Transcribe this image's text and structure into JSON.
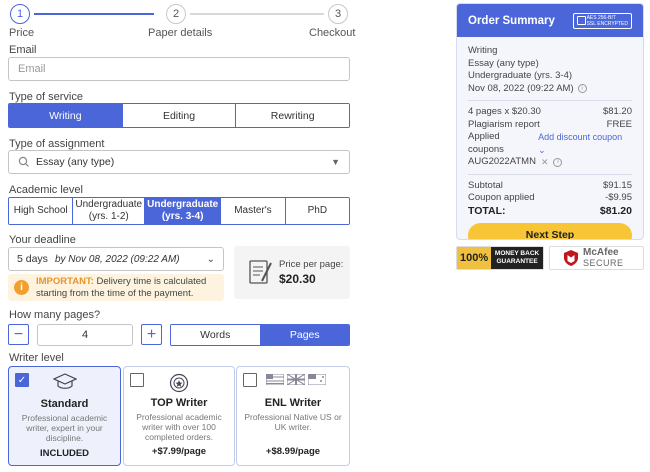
{
  "stepper": {
    "steps": [
      {
        "number": "1",
        "label": "Price"
      },
      {
        "number": "2",
        "label": "Paper details"
      },
      {
        "number": "3",
        "label": "Checkout"
      }
    ]
  },
  "email": {
    "label": "Email",
    "placeholder": "Email"
  },
  "service": {
    "label": "Type of service",
    "options": [
      "Writing",
      "Editing",
      "Rewriting"
    ],
    "selected": "Writing"
  },
  "assignment": {
    "label": "Type of assignment",
    "value": "Essay (any type)"
  },
  "academic": {
    "label": "Academic level",
    "options": [
      "High School",
      "Undergraduate (yrs. 1-2)",
      "Undergraduate (yrs. 3-4)",
      "Master's",
      "PhD"
    ],
    "selected": "Undergraduate (yrs. 3-4)"
  },
  "deadline": {
    "label": "Your deadline",
    "days": "5 days",
    "date": "by Nov 08, 2022 (09:22 AM)",
    "notice_strong": "IMPORTANT:",
    "notice_text": "Delivery time is calculated starting from the time of the payment."
  },
  "price_per_page": {
    "label": "Price per page:",
    "value": "$20.30"
  },
  "pages": {
    "label": "How many pages?",
    "minus": "−",
    "value": "4",
    "plus": "+",
    "units": [
      "Words",
      "Pages"
    ],
    "selected_unit": "Pages"
  },
  "writer": {
    "label": "Writer level",
    "cards": [
      {
        "title": "Standard",
        "desc": "Professional academic writer, expert in your discipline.",
        "price": "INCLUDED",
        "checked": true
      },
      {
        "title": "TOP Writer",
        "desc": "Professional academic writer with over 100 completed orders.",
        "price": "+$7.99/page",
        "checked": false
      },
      {
        "title": "ENL Writer",
        "desc": "Professional Native US or UK writer.",
        "price": "+$8.99/page",
        "checked": false
      }
    ]
  },
  "summary": {
    "title": "Order Summary",
    "ssl_line1": "AES 256-BIT",
    "ssl_line2": "SSL ENCRYPTED",
    "service": "Writing",
    "assignment": "Essay (any type)",
    "level": "Undergraduate (yrs. 3-4)",
    "deadline": "Nov 08, 2022 (09:22 AM)",
    "pages_line": "4 pages x $20.30",
    "pages_amount": "$81.20",
    "plagiarism_label": "Plagiarism report",
    "plagiarism_value": "FREE",
    "coupons_label": "Applied coupons",
    "add_discount": "Add discount coupon",
    "coupon_code": "AUG2022ATMN",
    "subtotal_label": "Subtotal",
    "subtotal_value": "$91.15",
    "coupon_applied_label": "Coupon applied",
    "coupon_applied_value": "-$9.95",
    "total_label": "TOTAL:",
    "total_value": "$81.20",
    "next_button": "Next Step"
  },
  "badges": {
    "money_back_percent": "100%",
    "money_back_line1": "MONEY BACK",
    "money_back_line2": "GUARANTEE",
    "mcafee_line1": "McAfee",
    "mcafee_line2": "SECURE"
  },
  "colors": {
    "accent": "#4a66d8",
    "next_button": "#f7c535",
    "notice_bg": "#fdf3df",
    "notice_icon": "#f0a030"
  }
}
